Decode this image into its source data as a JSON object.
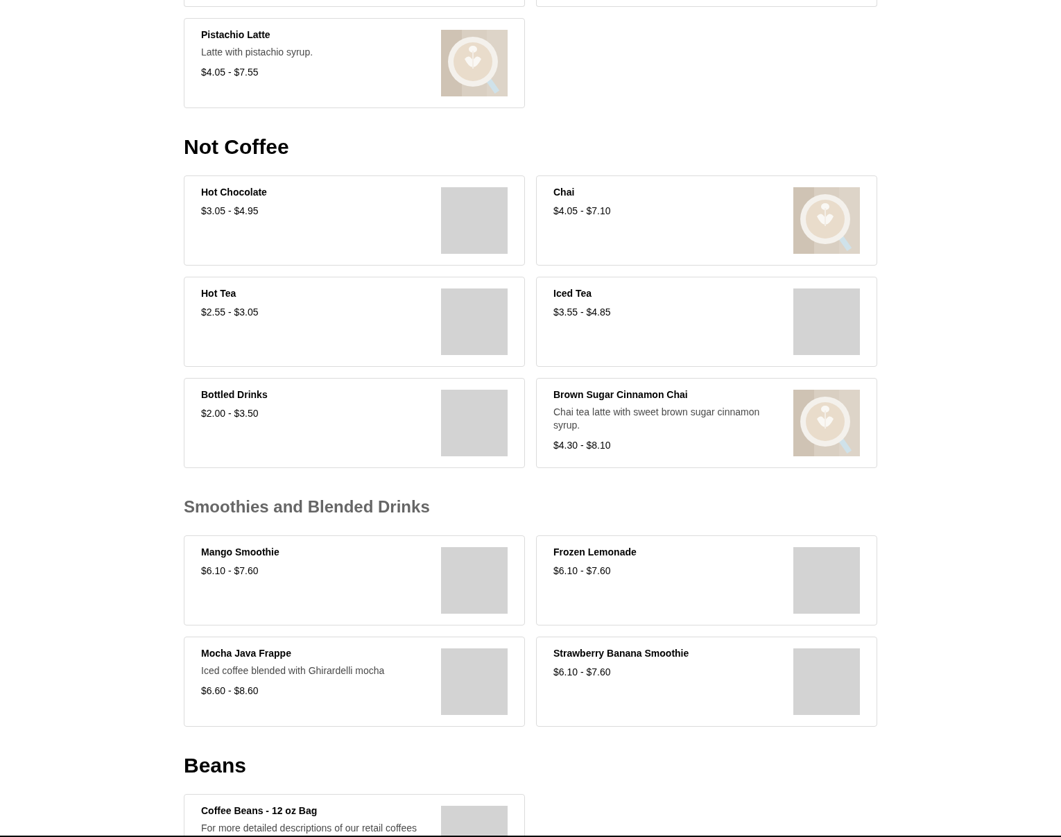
{
  "sections": [
    {
      "items": [
        {
          "kind": "cut"
        },
        {
          "kind": "cut"
        },
        {
          "name": "Pistachio Latte",
          "description": "Latte with pistachio syrup.",
          "price": "$4.05 - $7.55"
        }
      ]
    },
    {
      "heading": {
        "text": "Not Coffee",
        "dimmed": false
      },
      "items": [
        {
          "kind": "placeholder",
          "name": "Hot Chocolate",
          "price": "$3.05 - $4.95"
        },
        {
          "name": "Chai",
          "price": "$4.05 - $7.10"
        },
        {
          "kind": "placeholder",
          "name": "Hot Tea",
          "price": "$2.55 - $3.05"
        },
        {
          "kind": "placeholder",
          "name": "Iced Tea",
          "price": "$3.55 - $4.85"
        },
        {
          "kind": "placeholder",
          "name": "Bottled Drinks",
          "price": "$2.00 - $3.50"
        },
        {
          "name": "Brown Sugar Cinnamon Chai",
          "description": "Chai tea latte with sweet brown sugar cinnamon syrup.",
          "price": "$4.30 - $8.10"
        }
      ]
    },
    {
      "heading": {
        "text": "Smoothies and Blended Drinks",
        "dimmed": true
      },
      "items": [
        {
          "kind": "placeholder",
          "name": "Mango Smoothie",
          "price": "$6.10 - $7.60"
        },
        {
          "kind": "placeholder",
          "name": "Frozen Lemonade",
          "price": "$6.10 - $7.60"
        },
        {
          "kind": "placeholder",
          "name": "Mocha Java Frappe",
          "description": "Iced coffee blended with Ghirardelli mocha",
          "price": "$6.60 - $8.60"
        },
        {
          "kind": "placeholder",
          "name": "Strawberry Banana Smoothie",
          "price": "$6.10 - $7.60"
        }
      ]
    },
    {
      "heading": {
        "text": "Beans",
        "dimmed": false
      },
      "items": [
        {
          "kind": "placeholder",
          "name": "Coffee Beans - 12 oz Bag",
          "description": "For more detailed descriptions of our retail coffees"
        }
      ]
    }
  ]
}
